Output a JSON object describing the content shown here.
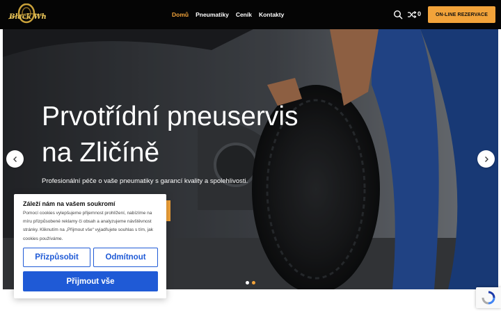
{
  "header": {
    "logo_alt": "Black Wheels",
    "nav": [
      {
        "label": "Domů",
        "active": true
      },
      {
        "label": "Pneumatiky",
        "active": false
      },
      {
        "label": "Ceník",
        "active": false
      },
      {
        "label": "Kontakty",
        "active": false
      }
    ],
    "compare_count": "0",
    "reserve_label": "ON-LINE REZERVACE",
    "icons": [
      "search-icon",
      "shuffle-icon"
    ]
  },
  "hero": {
    "title_line1": "Prvotřídní pneuservis",
    "title_line2": "na Zličíně",
    "subtitle": "Profesionální péče o vaše pneumatiky s garancí kvality a spolehlivosti.",
    "slides": 2,
    "active_slide": 2
  },
  "cookie": {
    "title": "Záleží nám na vašem soukromí",
    "text": "Pomocí cookies vylepšujeme přijemnost prohlížení, nabízíme na míru přizpůsobené reklamy či obsah a analyzujeme návštěvnost stránky. Kliknutím na „Přijmout vše“ vyjadřujete souhlas s tím, jak cookies používáme.",
    "customize_label": "Přizpůsobit",
    "reject_label": "Odmítnout",
    "accept_label": "Přijmout vše"
  },
  "colors": {
    "accent": "#f2a33a",
    "header_bg": "#050505",
    "cookie_primary": "#1f5ad6"
  }
}
